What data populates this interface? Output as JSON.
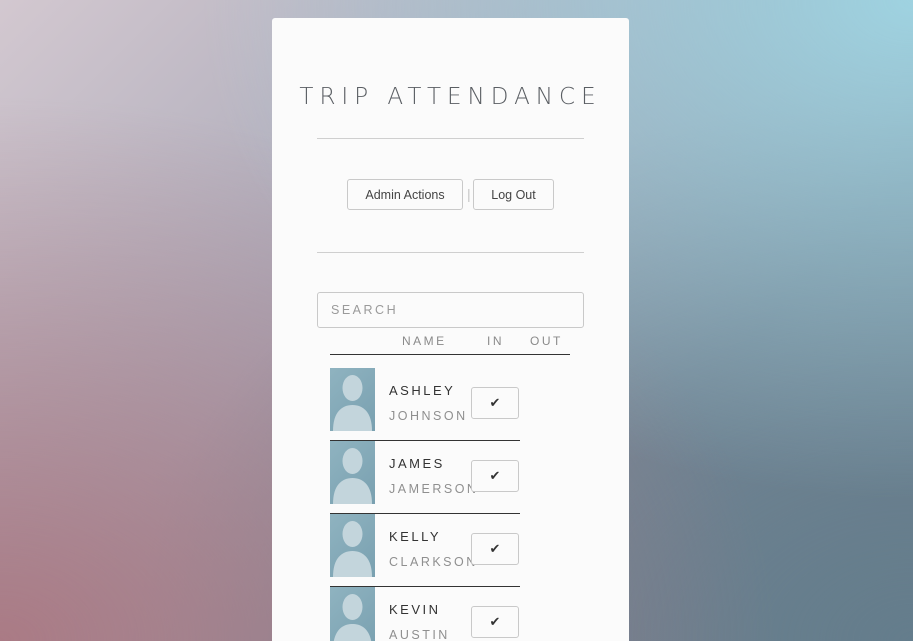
{
  "app": {
    "title": "TRIP ATTENDANCE"
  },
  "actions": {
    "admin_label": "Admin Actions",
    "separator": "|",
    "logout_label": "Log Out"
  },
  "search": {
    "placeholder": "SEARCH",
    "value": ""
  },
  "table": {
    "headers": {
      "name": "NAME",
      "in": "IN",
      "out": "OUT"
    },
    "check_glyph": "✔",
    "rows": [
      {
        "first": "ASHLEY",
        "last": "JOHNSON"
      },
      {
        "first": "JAMES",
        "last": "JAMERSON"
      },
      {
        "first": "KELLY",
        "last": "CLARKSON"
      },
      {
        "first": "KEVIN",
        "last": "AUSTIN"
      }
    ]
  },
  "icons": {
    "avatar": "person-silhouette-icon",
    "check": "check-icon"
  },
  "colors": {
    "card_bg": "#fbfbfb",
    "avatar_bg": "#8fb3c0",
    "avatar_figure": "#c3d5dc",
    "title_text": "#5a5e63"
  }
}
